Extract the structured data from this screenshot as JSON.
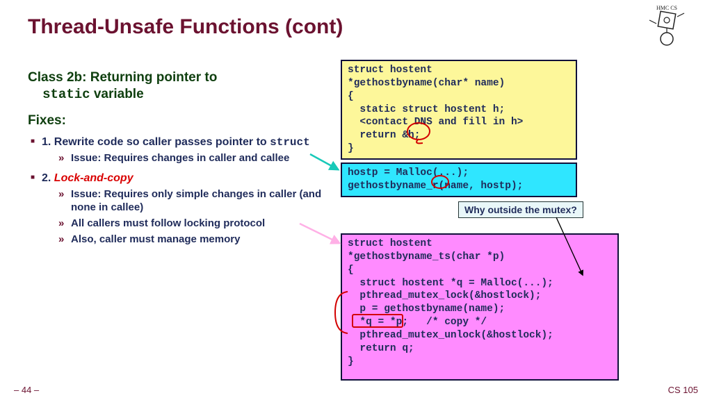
{
  "title": "Thread-Unsafe Functions (cont)",
  "logo_label": "HMC CS",
  "left": {
    "class_hdr_a": "Class 2b: Returning pointer to ",
    "class_hdr_b": "static",
    "class_hdr_c": " variable",
    "fixes": "Fixes:",
    "fix1_a": "1. Rewrite code so caller passes pointer to ",
    "fix1_b": "struct",
    "fix1_issue": "Issue: Requires changes in caller and callee",
    "fix2_a": "2. ",
    "fix2_b": "Lock-and-copy",
    "fix2_issue1": "Issue: Requires only simple changes in caller (and none in callee)",
    "fix2_issue2": "All callers must follow locking protocol",
    "fix2_issue3": "Also, caller must manage memory"
  },
  "code": {
    "yellow": "struct hostent\n*gethostbyname(char* name)\n{\n  static struct hostent h;\n  <contact DNS and fill in h>\n  return &h;\n}",
    "cyan": "hostp = Malloc(...);\ngethostbyname_r(name, hostp);",
    "pink": "struct hostent\n*gethostbyname_ts(char *p)\n{\n  struct hostent *q = Malloc(...);\n  pthread_mutex_lock(&hostlock);\n  p = gethostbyname(name);\n  *q = *p;   /* copy */\n  pthread_mutex_unlock(&hostlock);\n  return q;\n}"
  },
  "callout": "Why outside the mutex?",
  "footer": {
    "page": "– 44 –",
    "course": "CS 105"
  }
}
